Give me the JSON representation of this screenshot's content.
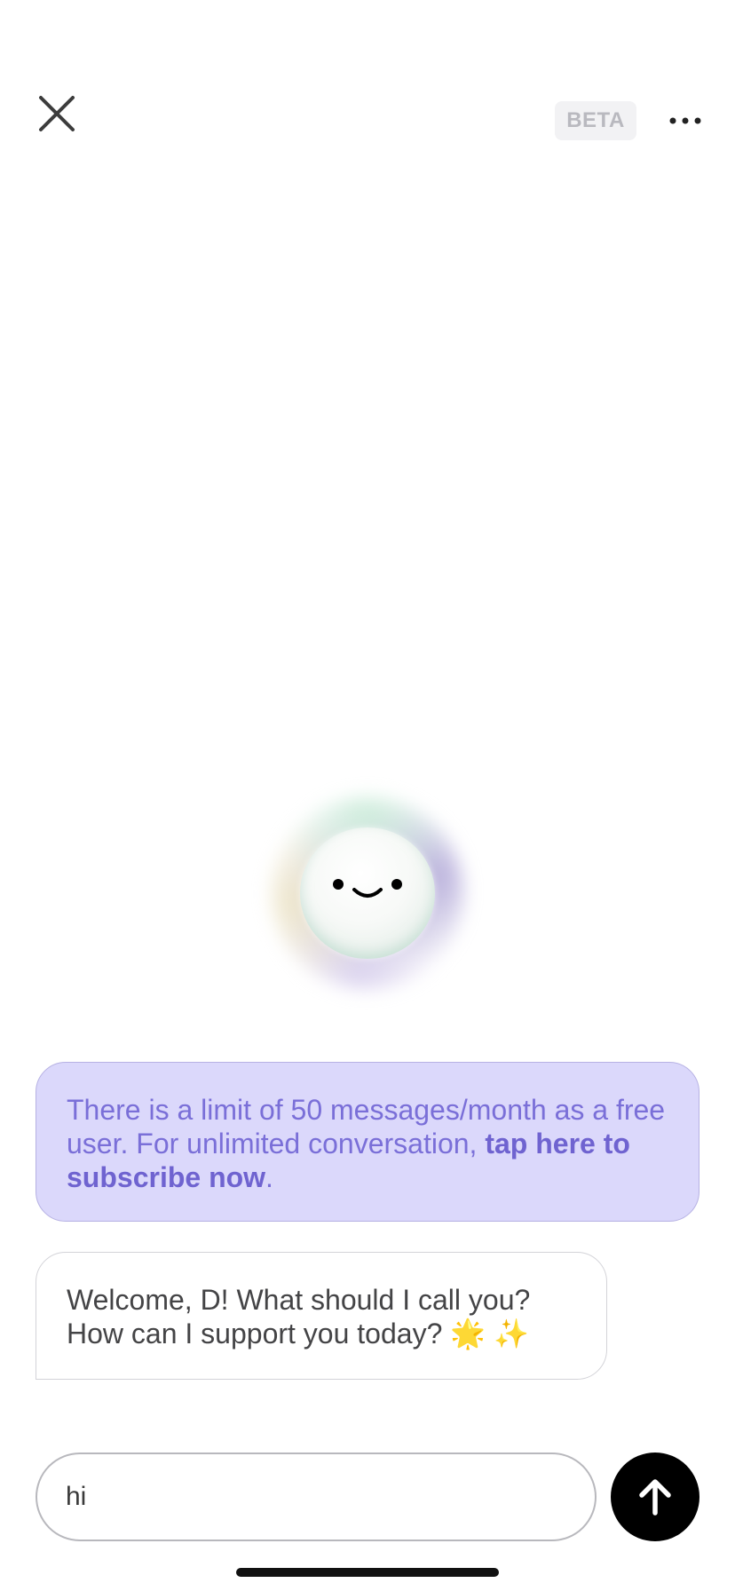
{
  "header": {
    "close_icon": "close-icon",
    "beta_label": "BETA",
    "more_icon": "more-horizontal-icon"
  },
  "assistant": {
    "avatar_icon": "smiley-orb-icon"
  },
  "messages": {
    "limit_notice": {
      "text": "There is a limit of 50 messages/month as a free user. For unlimited conversation, ",
      "cta": "tap here to subscribe now",
      "suffix": "."
    },
    "welcome": {
      "text": "Welcome, D! What should I call you? How can I support you today? 🌟 ✨"
    }
  },
  "composer": {
    "input_value": "hi",
    "send_icon": "arrow-up-icon"
  },
  "colors": {
    "notice_bg": "#dbd8fb",
    "notice_text": "#7a6fd8",
    "send_bg": "#000000",
    "badge_bg": "#f2f2f4"
  }
}
